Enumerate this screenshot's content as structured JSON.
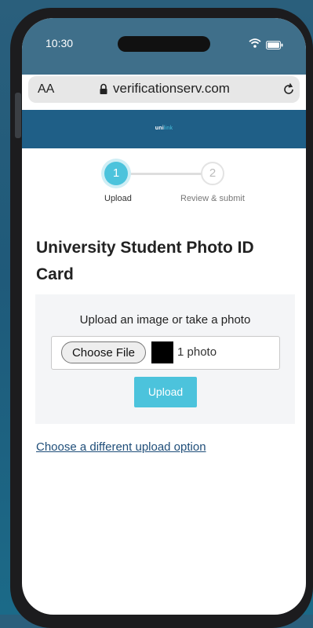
{
  "status_bar": {
    "time": "10:30"
  },
  "browser": {
    "text_size_label": "AA",
    "url": "verificationserv.com"
  },
  "brand": {
    "logo_part1": "uni",
    "logo_part2": "link"
  },
  "stepper": {
    "steps": [
      {
        "number": "1",
        "label": "Upload",
        "state": "active"
      },
      {
        "number": "2",
        "label": "Review & submit",
        "state": "inactive"
      }
    ]
  },
  "page": {
    "title": "University Student Photo ID Card",
    "upload_prompt": "Upload an image or take a photo",
    "choose_file_label": "Choose File",
    "file_status": "1 photo",
    "upload_button": "Upload",
    "alt_option_link": "Choose a different upload option"
  },
  "colors": {
    "accent": "#4cc3dc",
    "brand_bar": "#1f5f87",
    "link": "#1f4e79"
  }
}
